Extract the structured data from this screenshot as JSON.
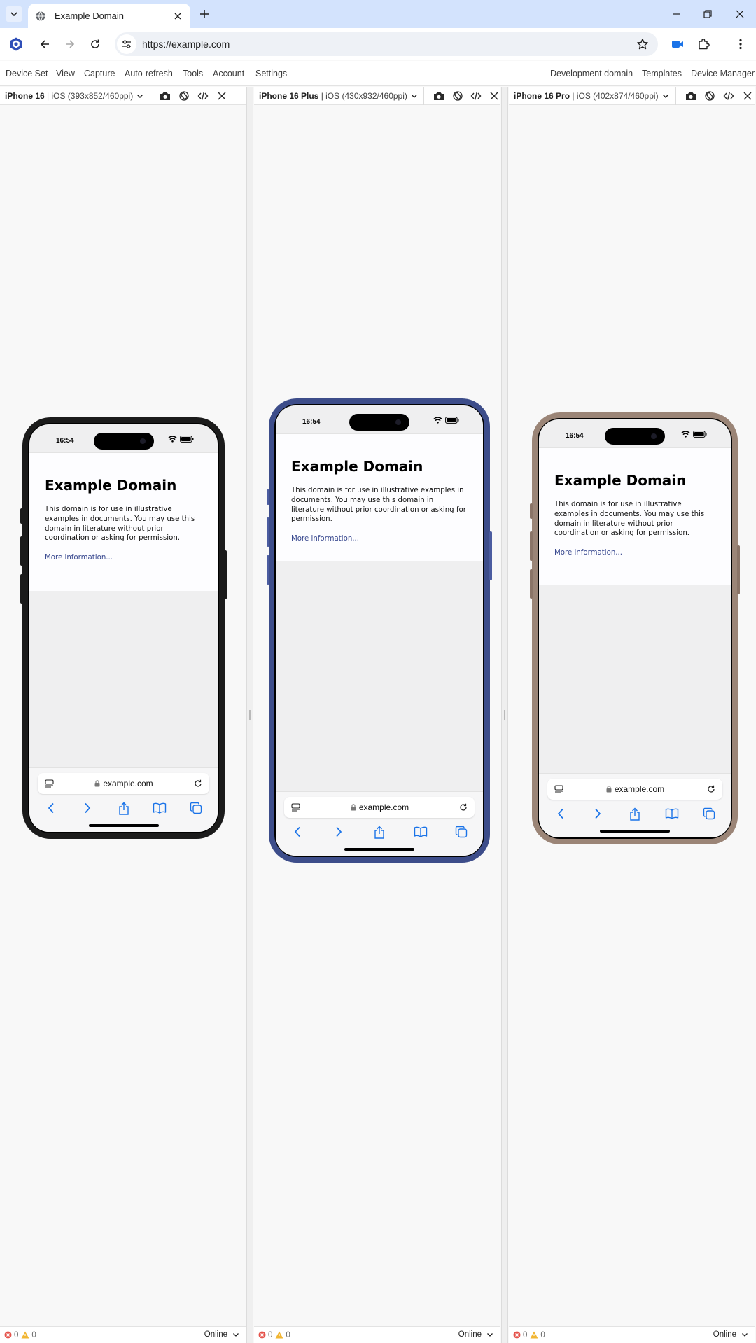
{
  "browser": {
    "tab_title": "Example Domain",
    "url": "https://example.com"
  },
  "menubar": {
    "left": [
      "Device Set",
      "View",
      "Capture",
      "Auto-refresh",
      "Tools",
      "Account",
      "Settings"
    ],
    "right": [
      "Development domain",
      "Templates",
      "Device Manager"
    ]
  },
  "panels": [
    {
      "device": "iPhone 16",
      "spec": "iOS (393x852/460ppi)",
      "errors": "0",
      "warnings": "0",
      "network": "Online",
      "frame_color": "#1b1b1b",
      "button_color": "#1b1b1b"
    },
    {
      "device": "iPhone 16 Plus",
      "spec": "iOS (430x932/460ppi)",
      "errors": "0",
      "warnings": "0",
      "network": "Online",
      "frame_color": "#3d4d8a",
      "button_color": "#4b5ca0"
    },
    {
      "device": "iPhone 16 Pro",
      "spec": "iOS (402x874/460ppi)",
      "errors": "0",
      "warnings": "0",
      "network": "Online",
      "frame_color": "#9b8577",
      "button_color": "#8a7467"
    }
  ],
  "phone": {
    "time": "16:54",
    "heading": "Example Domain",
    "body": "This domain is for use in illustrative examples in documents. You may use this domain in literature without prior coordination or asking for permission.",
    "link": "More information...",
    "address": "example.com"
  },
  "colors": {
    "tabstrip": "#d3e3fd",
    "accent": "#1a73e8",
    "link": "#38488f"
  }
}
